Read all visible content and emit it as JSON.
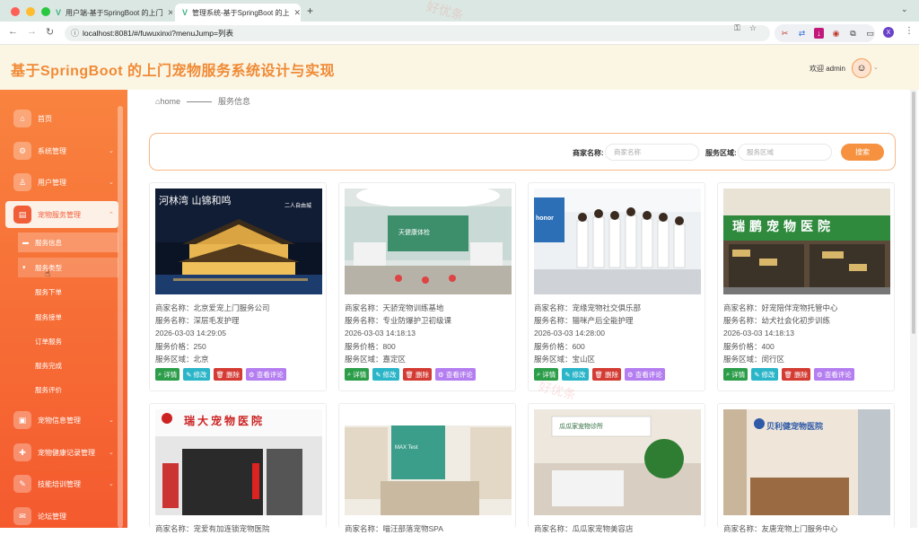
{
  "browser": {
    "tabs": [
      {
        "title": "用户端-基于SpringBoot 的上门"
      },
      {
        "title": "管理系统-基于SpringBoot 的上"
      }
    ],
    "url": "localhost:8081/#/fuwuxinxi?menuJump=列表",
    "profile_initial": "X"
  },
  "header": {
    "title": "基于SpringBoot 的上门宠物服务系统设计与实现",
    "welcome": "欢迎 admin"
  },
  "sidebar": {
    "items": [
      {
        "label": "首页",
        "icon": "home-icon"
      },
      {
        "label": "系统管理",
        "icon": "settings-icon"
      },
      {
        "label": "用户管理",
        "icon": "user-icon"
      },
      {
        "label": "宠物服务管理",
        "icon": "pet-service-icon"
      },
      {
        "label": "宠物信息管理",
        "icon": "pet-info-icon"
      },
      {
        "label": "宠物健康记录管理",
        "icon": "health-icon"
      },
      {
        "label": "技能培训管理",
        "icon": "training-icon"
      },
      {
        "label": "论坛管理",
        "icon": "forum-icon"
      }
    ],
    "subitems": [
      "服务信息",
      "服务类型",
      "服务下单",
      "服务接单",
      "订单服务",
      "服务完成",
      "服务评价"
    ]
  },
  "breadcrumb": {
    "home": "home",
    "current": "服务信息"
  },
  "search": {
    "merchant_label": "商家名称:",
    "merchant_placeholder": "商家名称",
    "area_label": "服务区域:",
    "area_placeholder": "服务区域",
    "button": "搜索"
  },
  "card_buttons": {
    "detail": "详情",
    "edit": "修改",
    "delete": "删除",
    "review": "查看评论"
  },
  "cards": [
    {
      "merchant": "商家名称：北京爱宠上门服务公司",
      "service": "服务名称：深层毛发护理",
      "time": "2026-03-03 14:29:05",
      "price": "服务价格：250",
      "area": "服务区域：北京"
    },
    {
      "merchant": "商家名称：天骄宠物训练基地",
      "service": "服务名称：专业防爆护卫初级课",
      "time": "2026-03-03 14:18:13",
      "price": "服务价格：800",
      "area": "服务区域：嘉定区"
    },
    {
      "merchant": "商家名称：宠缘宠物社交俱乐部",
      "service": "服务名称：猫咪产后全能护理",
      "time": "2026-03-03 14:28:00",
      "price": "服务价格：600",
      "area": "服务区域：宝山区"
    },
    {
      "merchant": "商家名称：好宠陪伴宠物托管中心",
      "service": "服务名称：幼犬社会化初步训练",
      "time": "2026-03-03 14:18:13",
      "price": "服务价格：400",
      "area": "服务区域：闵行区"
    },
    {
      "merchant": "商家名称：宠爱有加连锁宠物医院",
      "service": "",
      "time": "",
      "price": "",
      "area": ""
    },
    {
      "merchant": "商家名称：喵汪部落宠物SPA",
      "service": "",
      "time": "",
      "price": "",
      "area": ""
    },
    {
      "merchant": "商家名称：瓜瓜家宠物美容店",
      "service": "",
      "time": "",
      "price": "",
      "area": ""
    },
    {
      "merchant": "商家名称：友唐宠物上门服务中心",
      "service": "",
      "time": "",
      "price": "",
      "area": ""
    }
  ],
  "image_texts": {
    "img1": "河林湾  山锦和鸣",
    "img1b": "二人自由城",
    "img2": "天健康体检",
    "img3": "honor",
    "img4": "瑞鹏宠物医院",
    "img5": "瑞大宠物医院",
    "img6": "MAX Test",
    "img7": "瓜瓜家宠物诊所",
    "img8": "贝利健宠物医院"
  },
  "watermark": "好优条"
}
